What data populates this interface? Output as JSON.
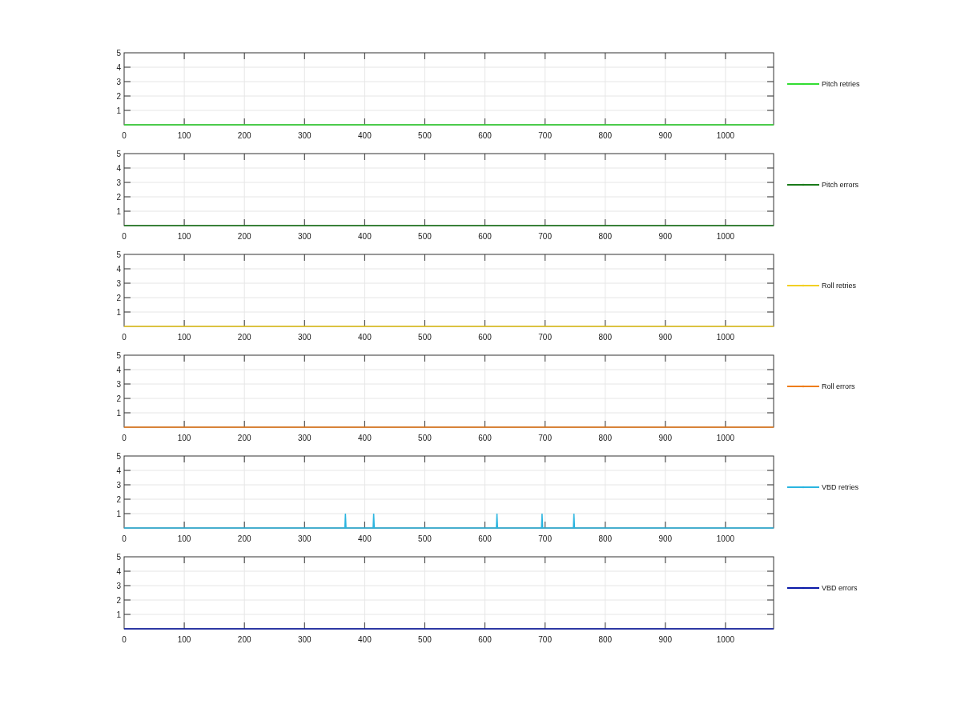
{
  "panels": [
    {
      "chart_data": {
        "type": "line",
        "x": [
          0,
          1080
        ],
        "series": [
          {
            "name": "Pitch retries",
            "color": "#33dd33",
            "values": [
              0,
              0
            ]
          }
        ],
        "xlim": [
          0,
          1080
        ],
        "ylim": [
          0,
          5
        ],
        "xticks": [
          0,
          100,
          200,
          300,
          400,
          500,
          600,
          700,
          800,
          900,
          1000
        ],
        "yticks": [
          1,
          2,
          3,
          4,
          5
        ],
        "grid": true
      }
    },
    {
      "chart_data": {
        "type": "line",
        "x": [
          0,
          1080
        ],
        "series": [
          {
            "name": "Pitch errors",
            "color": "#1a7a1a",
            "values": [
              0,
              0
            ]
          }
        ],
        "xlim": [
          0,
          1080
        ],
        "ylim": [
          0,
          5
        ],
        "xticks": [
          0,
          100,
          200,
          300,
          400,
          500,
          600,
          700,
          800,
          900,
          1000
        ],
        "yticks": [
          1,
          2,
          3,
          4,
          5
        ],
        "grid": true
      }
    },
    {
      "chart_data": {
        "type": "line",
        "x": [
          0,
          1080
        ],
        "series": [
          {
            "name": "Roll retries",
            "color": "#f2d024",
            "values": [
              0,
              0
            ]
          }
        ],
        "xlim": [
          0,
          1080
        ],
        "ylim": [
          0,
          5
        ],
        "xticks": [
          0,
          100,
          200,
          300,
          400,
          500,
          600,
          700,
          800,
          900,
          1000
        ],
        "yticks": [
          1,
          2,
          3,
          4,
          5
        ],
        "grid": true
      }
    },
    {
      "chart_data": {
        "type": "line",
        "x": [
          0,
          1080
        ],
        "series": [
          {
            "name": "Roll errors",
            "color": "#ee7d1a",
            "values": [
              0,
              0
            ]
          }
        ],
        "xlim": [
          0,
          1080
        ],
        "ylim": [
          0,
          5
        ],
        "xticks": [
          0,
          100,
          200,
          300,
          400,
          500,
          600,
          700,
          800,
          900,
          1000
        ],
        "yticks": [
          1,
          2,
          3,
          4,
          5
        ],
        "grid": true
      }
    },
    {
      "chart_data": {
        "type": "line",
        "x": [
          0,
          367,
          368,
          369,
          414,
          415,
          416,
          619,
          620,
          621,
          694,
          695,
          696,
          747,
          748,
          749,
          1080
        ],
        "series": [
          {
            "name": "VBD retries",
            "color": "#2bb5e0",
            "values": [
              0,
              0,
              1,
              0,
              0,
              1,
              0,
              0,
              1,
              0,
              0,
              1,
              0,
              0,
              1,
              0,
              0
            ]
          }
        ],
        "xlim": [
          0,
          1080
        ],
        "ylim": [
          0,
          5
        ],
        "xticks": [
          0,
          100,
          200,
          300,
          400,
          500,
          600,
          700,
          800,
          900,
          1000
        ],
        "yticks": [
          1,
          2,
          3,
          4,
          5
        ],
        "grid": true
      }
    },
    {
      "chart_data": {
        "type": "line",
        "x": [
          0,
          1080
        ],
        "series": [
          {
            "name": "VBD errors",
            "color": "#0a1aa8",
            "values": [
              0,
              0
            ]
          }
        ],
        "xlim": [
          0,
          1080
        ],
        "ylim": [
          0,
          5
        ],
        "xticks": [
          0,
          100,
          200,
          300,
          400,
          500,
          600,
          700,
          800,
          900,
          1000
        ],
        "yticks": [
          1,
          2,
          3,
          4,
          5
        ],
        "grid": true
      }
    }
  ]
}
